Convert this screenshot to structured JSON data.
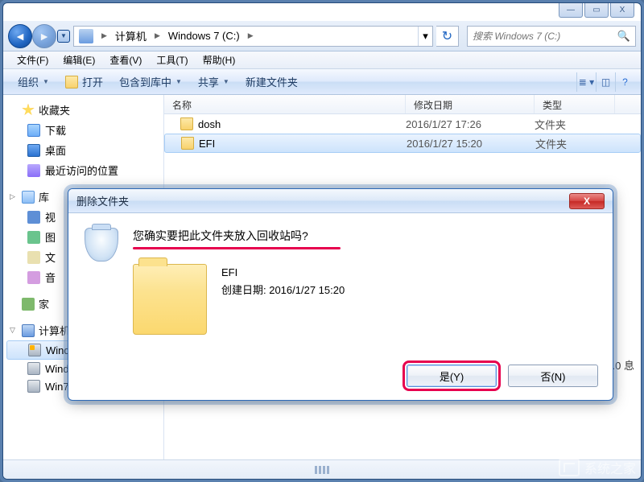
{
  "window": {
    "controls": {
      "min": "— ",
      "max": "▭",
      "close": "X"
    }
  },
  "nav": {
    "breadcrumb": {
      "computer": "计算机",
      "drive": "Windows 7 (C:)"
    },
    "search_placeholder": "搜索 Windows 7 (C:)"
  },
  "menubar": {
    "file": "文件(F)",
    "edit": "编辑(E)",
    "view": "查看(V)",
    "tools": "工具(T)",
    "help": "帮助(H)"
  },
  "toolbar": {
    "organize": "组织",
    "open": "打开",
    "include": "包含到库中",
    "share": "共享",
    "newfolder": "新建文件夹"
  },
  "columns": {
    "name": "名称",
    "date": "修改日期",
    "type": "类型"
  },
  "rows": [
    {
      "name": "dosh",
      "date": "2016/1/27 17:26",
      "type": "文件夹"
    },
    {
      "name": "EFI",
      "date": "2016/1/27 15:20",
      "type": "文件夹"
    }
  ],
  "sidebar": {
    "fav": {
      "title": "收藏夹",
      "downloads": "下载",
      "desktop": "桌面",
      "recent": "最近访问的位置"
    },
    "lib": {
      "title": "库",
      "video_short": "视",
      "pic_short": "图",
      "doc_short": "文",
      "music_short": "音"
    },
    "home": {
      "title": "家"
    },
    "computer": {
      "title": "计算机",
      "c": "Windows 7 (C:)",
      "d": "Windows 10 (D:)",
      "e": "Win7_64 (E:)"
    }
  },
  "dialog": {
    "title": "删除文件夹",
    "message": "您确实要把此文件夹放入回收站吗?",
    "item_name": "EFI",
    "created_label": "创建日期: 2016/1/27 15:20",
    "yes": "是(Y)",
    "no": "否(N)"
  },
  "peek_text": "e 9.0 息",
  "watermark": "系统之家"
}
